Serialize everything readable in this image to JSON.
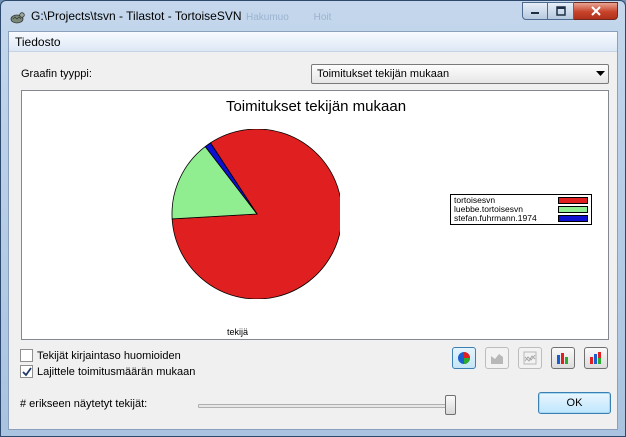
{
  "window": {
    "title": "G:\\Projects\\tsvn - Tilastot - TortoiseSVN",
    "ghost_menu": [
      "Hakumuo",
      "Hoit"
    ]
  },
  "menu": {
    "file": "Tiedosto"
  },
  "graph_type": {
    "label": "Graafin tyyppi:",
    "selected": "Toimitukset tekijän mukaan"
  },
  "chart_data": {
    "type": "pie",
    "title": "Toimitukset tekijän mukaan",
    "xlabel": "tekijä",
    "series": [
      {
        "name": "tortoisesvn",
        "value": 83.3,
        "color": "#e02020"
      },
      {
        "name": "luebbe.tortoisesvn",
        "value": 15.5,
        "color": "#90ee90"
      },
      {
        "name": "stefan.fuhrmann.1974",
        "value": 1.2,
        "color": "#1010d0"
      }
    ],
    "legend_position": "right"
  },
  "options": {
    "ignore_case": {
      "label": "Tekijät kirjaintaso huomioiden",
      "checked": false
    },
    "sort_by_commits": {
      "label": "Lajittele toimitusmäärän mukaan",
      "checked": true
    }
  },
  "toolbar": {
    "buttons": [
      "pie-chart-icon",
      "area-chart-icon",
      "stacked-line-chart-icon",
      "bar-chart-icon",
      "stacked-bar-chart-icon"
    ]
  },
  "slider": {
    "label": "# erikseen näytetyt tekijät:",
    "value_fraction": 0.97
  },
  "ok_button": "OK"
}
